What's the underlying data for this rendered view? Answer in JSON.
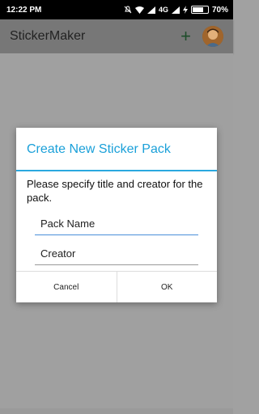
{
  "status_bar": {
    "time": "12:22 PM",
    "network": "4G",
    "battery": "70%",
    "battery_level": 0.7
  },
  "app_bar": {
    "title": "StickerMaker",
    "add_icon": "plus-icon",
    "avatar_icon": "avatar"
  },
  "dialog": {
    "title": "Create New Sticker Pack",
    "message": "Please specify title and creator for the pack.",
    "pack_name_placeholder": "Pack Name",
    "creator_placeholder": "Creator",
    "cancel_label": "Cancel",
    "ok_label": "OK"
  },
  "colors": {
    "accent": "#1aa0d9",
    "app_bar": "#777777",
    "scrim": "#a0a0a0"
  }
}
